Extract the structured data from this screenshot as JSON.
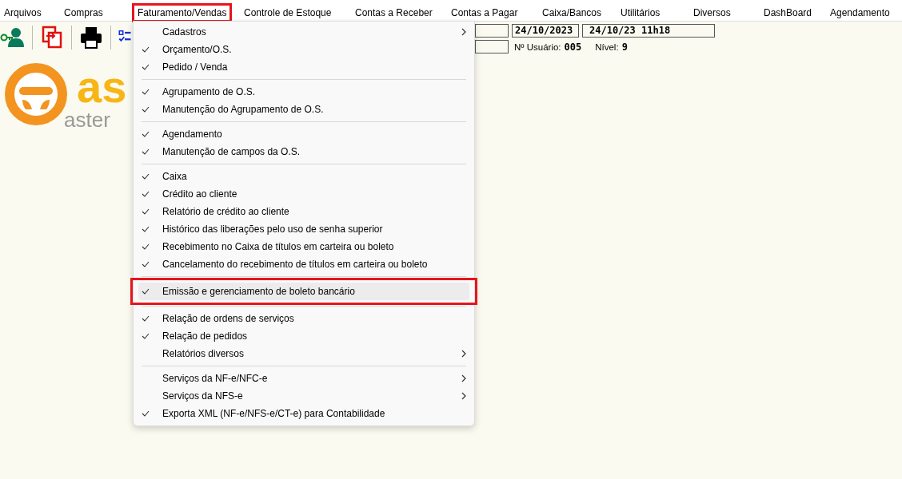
{
  "menubar": [
    {
      "label": "Arquivos",
      "selected": false
    },
    {
      "label": "Compras",
      "selected": false
    },
    {
      "label": "Faturamento/Vendas",
      "selected": true
    },
    {
      "label": "Controle de Estoque",
      "selected": false
    },
    {
      "label": "Contas a Receber",
      "selected": false
    },
    {
      "label": "Contas a Pagar",
      "selected": false
    },
    {
      "label": "Caixa/Bancos",
      "selected": false
    },
    {
      "label": "Utilitários",
      "selected": false
    },
    {
      "label": "Diversos",
      "selected": false
    },
    {
      "label": "DashBoard",
      "selected": false
    },
    {
      "label": "Agendamento",
      "selected": false
    }
  ],
  "info": {
    "date": "24/10/2023",
    "datetime": "24/10/23 11h18",
    "user_label": "Nº Usuário:",
    "user": "005",
    "level_label": "Nível:",
    "level_value": "9"
  },
  "logo": {
    "mark": "as",
    "subtitle": "aster"
  },
  "menu": {
    "groups": [
      [
        {
          "label": "Cadastros",
          "checked": false,
          "submenu": true,
          "selected": false
        },
        {
          "label": "Orçamento/O.S.",
          "checked": true,
          "submenu": false,
          "selected": false
        },
        {
          "label": "Pedido / Venda",
          "checked": true,
          "submenu": false,
          "selected": false
        }
      ],
      [
        {
          "label": "Agrupamento de O.S.",
          "checked": true,
          "submenu": false,
          "selected": false
        },
        {
          "label": "Manutenção do Agrupamento de O.S.",
          "checked": true,
          "submenu": false,
          "selected": false
        }
      ],
      [
        {
          "label": "Agendamento",
          "checked": true,
          "submenu": false,
          "selected": false
        },
        {
          "label": "Manutenção de campos da O.S.",
          "checked": true,
          "submenu": false,
          "selected": false
        }
      ],
      [
        {
          "label": "Caixa",
          "checked": true,
          "submenu": false,
          "selected": false
        },
        {
          "label": "Crédito ao cliente",
          "checked": true,
          "submenu": false,
          "selected": false
        },
        {
          "label": "Relatório de crédito ao cliente",
          "checked": true,
          "submenu": false,
          "selected": false
        },
        {
          "label": "Histórico das liberações pelo uso de senha superior",
          "checked": true,
          "submenu": false,
          "selected": false
        },
        {
          "label": "Recebimento no Caixa de títulos em carteira ou boleto",
          "checked": true,
          "submenu": false,
          "selected": false
        },
        {
          "label": "Cancelamento do recebimento de títulos em carteira ou boleto",
          "checked": true,
          "submenu": false,
          "selected": false
        }
      ],
      [
        {
          "label": "Emissão e gerenciamento de boleto bancário",
          "checked": true,
          "submenu": false,
          "selected": true
        }
      ],
      [
        {
          "label": "Relação de ordens de serviços",
          "checked": true,
          "submenu": false,
          "selected": false
        },
        {
          "label": "Relação de pedidos",
          "checked": true,
          "submenu": false,
          "selected": false
        },
        {
          "label": "Relatórios diversos",
          "checked": false,
          "submenu": true,
          "selected": false
        }
      ],
      [
        {
          "label": "Serviços da NF-e/NFC-e",
          "checked": false,
          "submenu": true,
          "selected": false
        },
        {
          "label": "Serviços da NFS-e",
          "checked": false,
          "submenu": true,
          "selected": false
        },
        {
          "label": "Exporta XML (NF-e/NFS-e/CT-e) para Contabilidade",
          "checked": true,
          "submenu": false,
          "selected": false
        }
      ]
    ]
  }
}
